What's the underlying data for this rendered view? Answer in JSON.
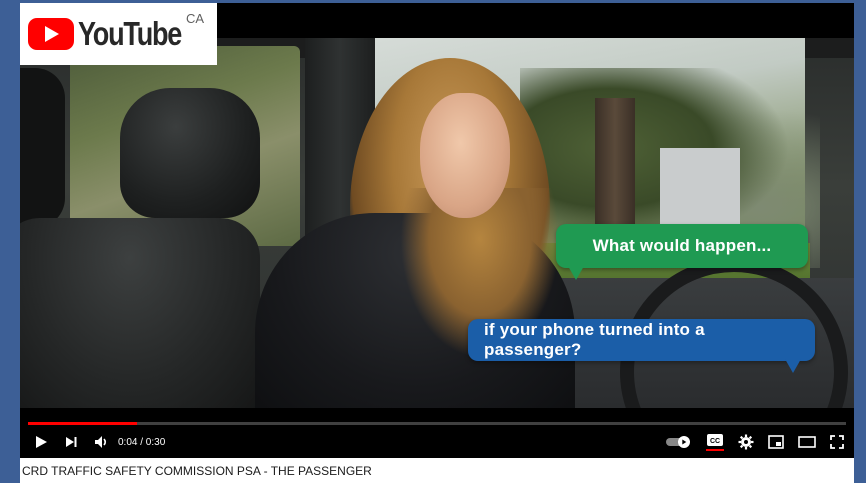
{
  "logo": {
    "wordmark": "YouTube",
    "region": "CA"
  },
  "video": {
    "subtitles": [
      "What would happen...",
      "if your phone turned into a passenger?"
    ]
  },
  "player": {
    "current_time": "0:04",
    "duration": "0:30",
    "time_display": "0:04 / 0:30",
    "progress_fraction": 0.133,
    "colors": {
      "progress": "#ff0000",
      "cc_active_underline": "#ff0000"
    },
    "icons": {
      "play": "play-icon",
      "next": "next-icon",
      "volume": "volume-icon",
      "autoplay": "autoplay-toggle-icon",
      "captions": "cc-icon",
      "settings": "gear-icon",
      "miniplayer": "miniplayer-icon",
      "theater": "theater-icon",
      "fullscreen": "fullscreen-icon"
    }
  },
  "video_title": "CRD TRAFFIC SAFETY COMMISSION PSA - THE PASSENGER"
}
